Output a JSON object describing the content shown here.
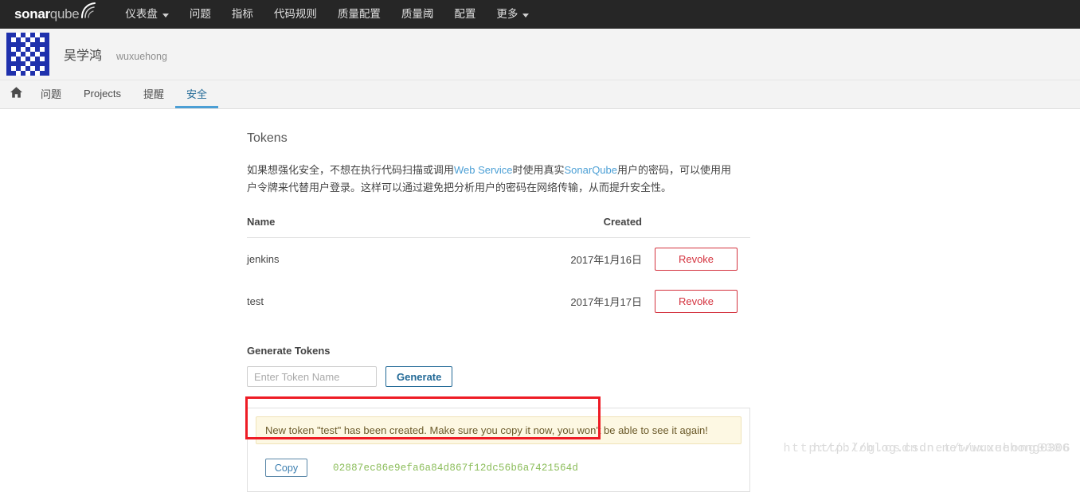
{
  "navbar": {
    "brand": {
      "sonar": "sonar",
      "qube": "qube",
      "icon": "sonarqube-wave-icon"
    },
    "items": [
      {
        "label": "仪表盘",
        "has_caret": true
      },
      {
        "label": "问题",
        "has_caret": false
      },
      {
        "label": "指标",
        "has_caret": false
      },
      {
        "label": "代码规则",
        "has_caret": false
      },
      {
        "label": "质量配置",
        "has_caret": false
      },
      {
        "label": "质量阈",
        "has_caret": false
      },
      {
        "label": "配置",
        "has_caret": false
      },
      {
        "label": "更多",
        "has_caret": true
      }
    ]
  },
  "profile": {
    "avatar_icon": "identicon-avatar",
    "full_name": "吴学鸿",
    "login": "wuxuehong"
  },
  "subnav": {
    "home_icon": "home-icon",
    "items": [
      {
        "label": "问题",
        "active": false
      },
      {
        "label": "Projects",
        "active": false
      },
      {
        "label": "提醒",
        "active": false
      },
      {
        "label": "安全",
        "active": true
      }
    ]
  },
  "main": {
    "title": "Tokens",
    "description": {
      "part1": "如果想强化安全，不想在执行代码扫描或调用",
      "hl1": "Web Service",
      "part2": "时使用真实",
      "hl2": "SonarQube",
      "part3": "用户的密码，可以使用用户令牌来代替用户登录。这样可以通过避免把分析用户的密码在网络传输，从而提升安全性。"
    },
    "table": {
      "headers": {
        "name": "Name",
        "created": "Created",
        "action": ""
      },
      "rows": [
        {
          "name": "jenkins",
          "created": "2017年1月16日",
          "action_label": "Revoke"
        },
        {
          "name": "test",
          "created": "2017年1月17日",
          "action_label": "Revoke"
        }
      ]
    },
    "generate": {
      "title": "Generate Tokens",
      "input_value": "",
      "input_placeholder": "Enter Token Name",
      "button_label": "Generate"
    },
    "result": {
      "alert_message": "New token \"test\" has been created. Make sure you copy it now, you won't be able to see it again!",
      "copy_label": "Copy",
      "token_value": "02887ec86e9efa6a84d867f12dc56b6a7421564d"
    }
  },
  "watermark": {
    "text_a": "http://blog.csdn.net/wuxuehong0306",
    "text_b": "http://blog.csdn.net/wuxuehong0306"
  },
  "colors": {
    "navbar_bg": "#262626",
    "accent_blue": "#4b9fd5",
    "link_blue": "#236a97",
    "danger_red": "#d4333f",
    "annotation_red": "#ee1c25",
    "token_green": "#8bbd5a",
    "alert_bg": "#fdf8e3"
  }
}
